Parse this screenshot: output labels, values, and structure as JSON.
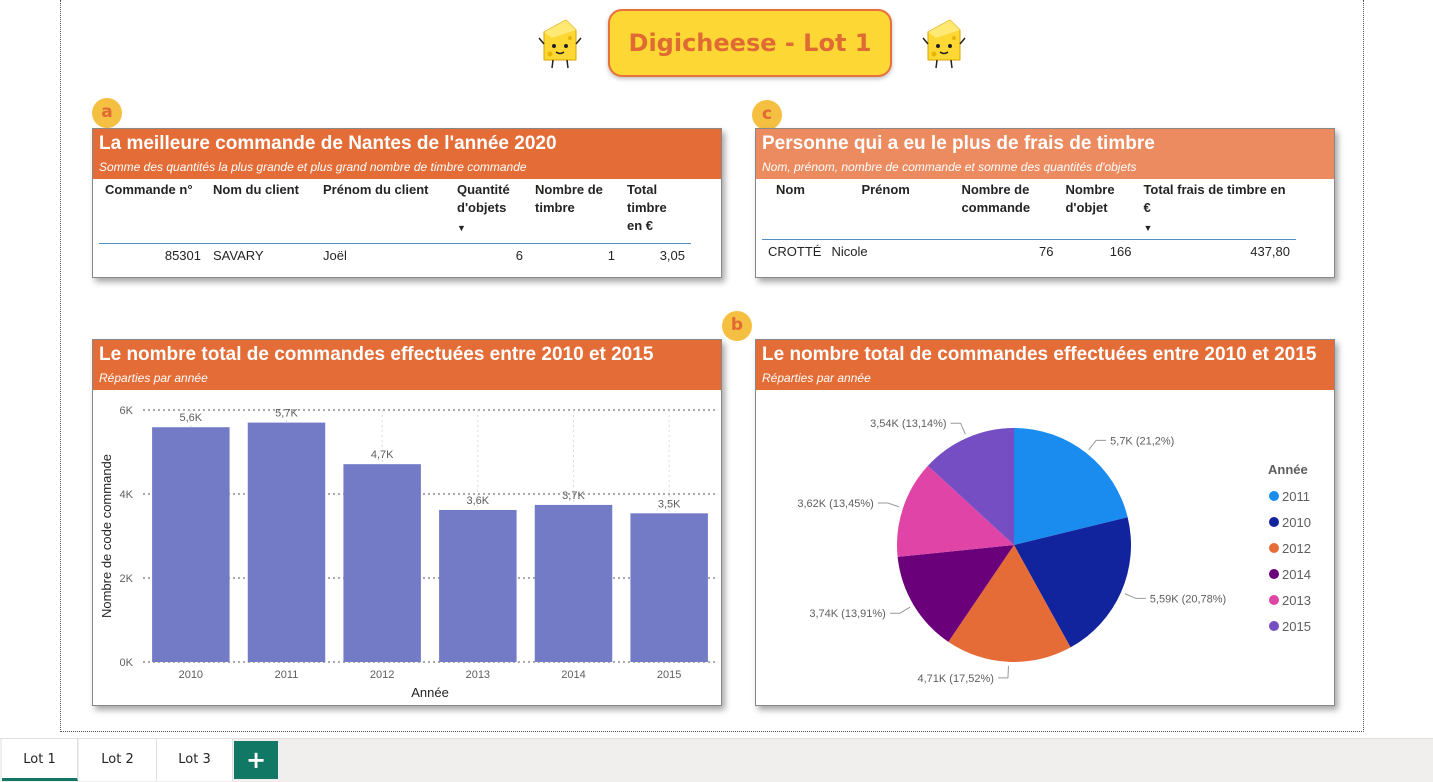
{
  "header": {
    "title": "Digicheese - Lot 1",
    "mascot_icon": "cheese-mascot-icon"
  },
  "badges": {
    "a": "a",
    "b": "b",
    "c": "c"
  },
  "card_a": {
    "title": "La meilleure commande de Nantes de l'année 2020",
    "subtitle": "Somme des quantités la plus grande et plus grand nombre de timbre commande",
    "columns": [
      "Commande n°",
      "Nom du client",
      "Prénom du client",
      "Quantité d'objets",
      "Nombre de timbre",
      "Total timbre en €"
    ],
    "row": {
      "commande": "85301",
      "nom": "SAVARY",
      "prenom": "Joël",
      "quantite": "6",
      "timbre": "1",
      "total": "3,05"
    }
  },
  "card_c": {
    "title": "Personne qui a eu le plus de frais de timbre",
    "subtitle": "Nom, prénom, nombre de commande et somme des quantités d'objets",
    "columns": [
      "Nom",
      "Prénom",
      "Nombre de commande",
      "Nombre d'objet",
      "Total frais de timbre en €"
    ],
    "row": {
      "nom": "CROTTÉ",
      "prenom": "Nicole",
      "commandes": "76",
      "objets": "166",
      "total": "437,80"
    }
  },
  "card_bar": {
    "title": "Le nombre total de commandes effectuées entre 2010 et 2015",
    "subtitle": "Réparties par année"
  },
  "card_pie": {
    "title": "Le nombre total de commandes effectuées entre 2010 et 2015",
    "subtitle": "Réparties par année"
  },
  "chart_data": [
    {
      "type": "bar",
      "categories": [
        "2010",
        "2011",
        "2012",
        "2013",
        "2014",
        "2015"
      ],
      "values": [
        5590,
        5700,
        4710,
        3620,
        3740,
        3540
      ],
      "data_labels": [
        "5,6K",
        "5,7K",
        "4,7K",
        "3,6K",
        "3,7K",
        "3,5K"
      ],
      "xlabel": "Année",
      "ylabel": "Nombre de code commande",
      "yticks": [
        "0K",
        "2K",
        "4K",
        "6K"
      ],
      "ylim": [
        0,
        6000
      ],
      "color": "#737ac6",
      "grid": true
    },
    {
      "type": "pie",
      "legend_title": "Année",
      "legend_position": "right",
      "slices": [
        {
          "label": "2011",
          "value": 5700,
          "text": "5,7K (21,2%)",
          "color": "#1a8cf0"
        },
        {
          "label": "2010",
          "value": 5590,
          "text": "5,59K (20,78%)",
          "color": "#12239e"
        },
        {
          "label": "2012",
          "value": 4710,
          "text": "4,71K (17,52%)",
          "color": "#e66c37"
        },
        {
          "label": "2014",
          "value": 3740,
          "text": "3,74K (13,91%)",
          "color": "#6b007b"
        },
        {
          "label": "2013",
          "value": 3620,
          "text": "3,62K (13,45%)",
          "color": "#e044a7"
        },
        {
          "label": "2015",
          "value": 3540,
          "text": "3,54K (13,14%)",
          "color": "#744ec2"
        }
      ]
    }
  ],
  "tabs": [
    {
      "label": "Lot 1",
      "active": true
    },
    {
      "label": "Lot 2",
      "active": false
    },
    {
      "label": "Lot 3",
      "active": false
    }
  ],
  "add_tab_label": "+"
}
